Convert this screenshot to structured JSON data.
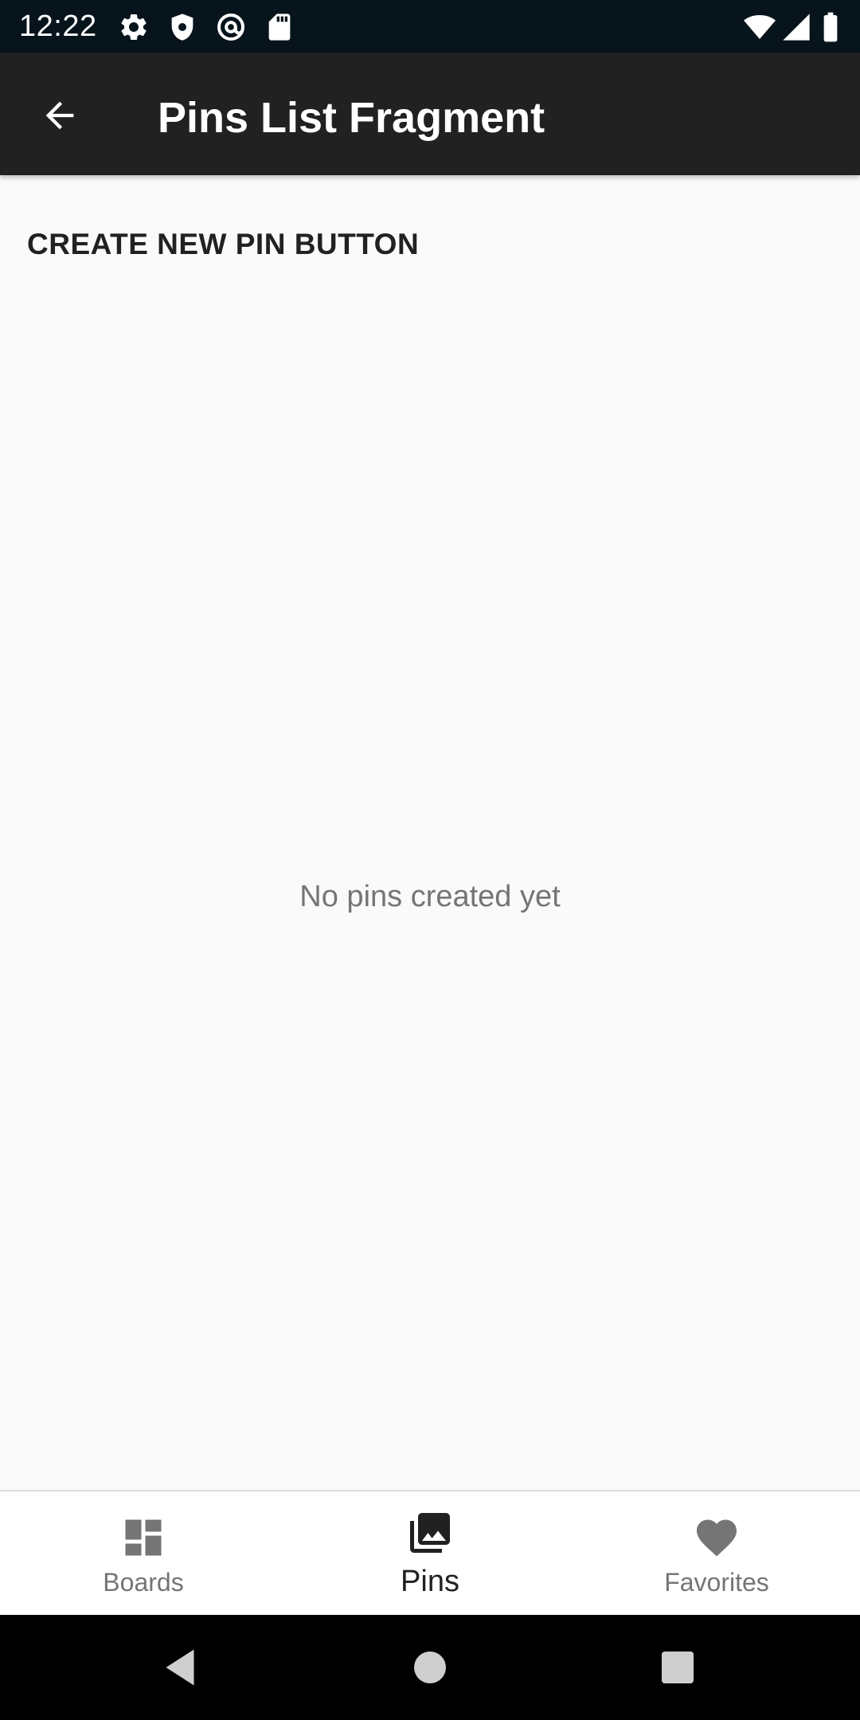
{
  "status_bar": {
    "time": "12:22",
    "icons": [
      "settings-icon",
      "shield-icon",
      "at-sign-icon",
      "sd-card-icon",
      "wifi-icon",
      "signal-icon",
      "battery-icon"
    ]
  },
  "app_bar": {
    "title": "Pins List Fragment",
    "back_icon": "arrow-back-icon"
  },
  "content": {
    "create_button_label": "CREATE NEW PIN BUTTON",
    "empty_message": "No pins created yet"
  },
  "bottom_nav": {
    "items": [
      {
        "label": "Boards",
        "icon": "dashboard-icon",
        "active": false
      },
      {
        "label": "Pins",
        "icon": "photo-library-icon",
        "active": true
      },
      {
        "label": "Favorites",
        "icon": "heart-icon",
        "active": false
      }
    ]
  },
  "system_nav": {
    "buttons": [
      "back-triangle-icon",
      "home-circle-icon",
      "recents-square-icon"
    ]
  },
  "colors": {
    "status_bar": "#07141c",
    "app_bar": "#212121",
    "background": "#fafafa",
    "nav_active": "#212121",
    "nav_inactive": "#757575"
  }
}
